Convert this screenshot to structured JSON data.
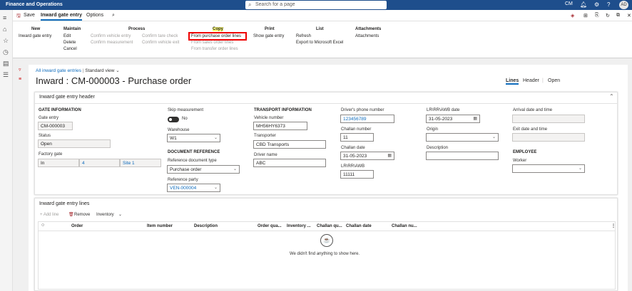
{
  "app": {
    "title": "Finance and Operations",
    "search_placeholder": "Search for a page",
    "company": "CM",
    "user_initials": "AD"
  },
  "action_row": {
    "save": "Save",
    "tab_active": "Inward gate entry",
    "options": "Options"
  },
  "ribbon": {
    "new": {
      "header": "New",
      "items": [
        "Inward gate entry"
      ]
    },
    "maintain": {
      "header": "Maintain",
      "items": [
        "Edit",
        "Delete",
        "Cancel"
      ]
    },
    "process": {
      "header": "Process",
      "col1": [
        "Confirm vehicle entry",
        "Confirm measurement"
      ],
      "col2": [
        "Confirm tare check",
        "Confirm vehicle exit"
      ]
    },
    "copy": {
      "header": "Copy",
      "items": [
        "From purchase order lines",
        "From sales order lines",
        "From transfer order lines"
      ]
    },
    "print": {
      "header": "Print",
      "items": [
        "Show gate entry"
      ]
    },
    "list": {
      "header": "List",
      "items": [
        "Refresh",
        "Export to Microsoft Excel"
      ]
    },
    "attachments": {
      "header": "Attachments",
      "items": [
        "Attachments"
      ]
    }
  },
  "breadcrumb": {
    "link": "All inward gate entries",
    "view": "Standard view"
  },
  "page_title": "Inward : CM-000003 - Purchase order",
  "right_tabs": {
    "lines": "Lines",
    "header": "Header",
    "open": "Open"
  },
  "header_section": {
    "title": "Inward gate entry header",
    "gate_info": {
      "title": "GATE INFORMATION",
      "gate_entry_label": "Gate entry",
      "gate_entry": "CM-000003",
      "status_label": "Status",
      "status": "Open",
      "factory_gate_label": "Factory gate",
      "factory_gate": "In",
      "factory_gate_num": "4",
      "factory_gate_site": "Site 1"
    },
    "skip": {
      "label": "Skip measurement",
      "value": "No"
    },
    "warehouse": {
      "label": "Warehouse",
      "value": "W1"
    },
    "docref": {
      "title": "DOCUMENT REFERENCE",
      "doc_type_label": "Reference document type",
      "doc_type": "Purchase order",
      "party_label": "Reference party",
      "party": "VEN-000004"
    },
    "transport": {
      "title": "TRANSPORT INFORMATION",
      "vehicle_label": "Vehicle number",
      "vehicle": "MH56HY6373",
      "transporter_label": "Transporter",
      "transporter": "CBD Transports",
      "driver_label": "Driver name",
      "driver": "ABC"
    },
    "driver_phone": {
      "label": "Driver's phone number",
      "value": "123456789"
    },
    "challan_number": {
      "label": "Challan number",
      "value": "11"
    },
    "challan_date": {
      "label": "Challan date",
      "value": "31-05-2023"
    },
    "lr": {
      "label": "LR\\RR\\AWB",
      "value": "11111"
    },
    "lr_date": {
      "label": "LR\\RR\\AWB date",
      "value": "31-05-2023"
    },
    "origin": {
      "label": "Origin",
      "value": ""
    },
    "description": {
      "label": "Description",
      "value": ""
    },
    "arrival": {
      "label": "Arrival date and time",
      "value": ""
    },
    "exit": {
      "label": "Exit date and time",
      "value": ""
    },
    "employee": {
      "title": "EMPLOYEE",
      "worker_label": "Worker",
      "worker": ""
    }
  },
  "lines_section": {
    "title": "Inward gate entry lines",
    "toolbar": {
      "add": "+ Add line",
      "remove": "Remove",
      "inventory": "Inventory"
    },
    "columns": [
      "Order",
      "Item number",
      "Description",
      "Order qua...",
      "Inventory ...",
      "Challan qu...",
      "Challan date",
      "Challan nu..."
    ],
    "empty_text": "We didn't find anything to show here."
  }
}
